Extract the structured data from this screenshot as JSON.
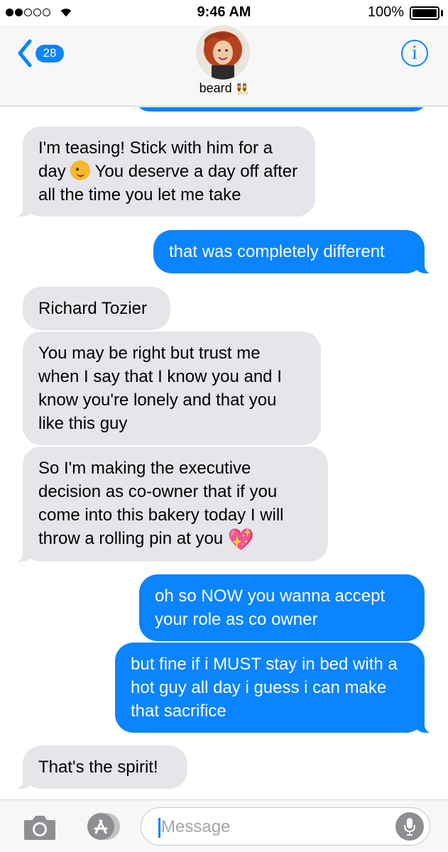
{
  "status_bar": {
    "time": "9:46 AM",
    "battery": "100%",
    "signal_bars_filled": 2,
    "signal_bars_total": 5
  },
  "header": {
    "unread_count": "28",
    "contact_name": "beard",
    "contact_emoji": "👯"
  },
  "messages": [
    {
      "direction": "incoming",
      "text_before_emoji": "I'm teasing! Stick with him for a day ",
      "emoji": "😉",
      "text_after_emoji": " You deserve a day off after all the time you let me take"
    },
    {
      "direction": "outgoing",
      "text": "that was completely different"
    },
    {
      "direction": "incoming",
      "text": "Richard Tozier"
    },
    {
      "direction": "incoming",
      "text": "You may be right but trust me when I say that I know you and I know you're lonely and that you like this guy"
    },
    {
      "direction": "incoming",
      "text": "So I'm making the executive decision as co-owner that if you come into this bakery today I will throw a rolling pin at you",
      "emoji": "💖"
    },
    {
      "direction": "outgoing",
      "text": "oh so NOW you wanna accept your role as co owner"
    },
    {
      "direction": "outgoing",
      "text": "but fine if i MUST stay in bed with a hot guy all day i guess i can make that sacrifice"
    },
    {
      "direction": "incoming",
      "text": "That's the spirit!"
    }
  ],
  "composer": {
    "placeholder": "Message"
  },
  "colors": {
    "outgoing_bubble": "#0a84ff",
    "incoming_bubble": "#e5e5ea",
    "accent": "#0a84ff"
  },
  "icons": [
    "back-chevron-icon",
    "info-icon",
    "camera-icon",
    "app-store-icon",
    "microphone-icon",
    "wifi-icon",
    "battery-icon"
  ]
}
